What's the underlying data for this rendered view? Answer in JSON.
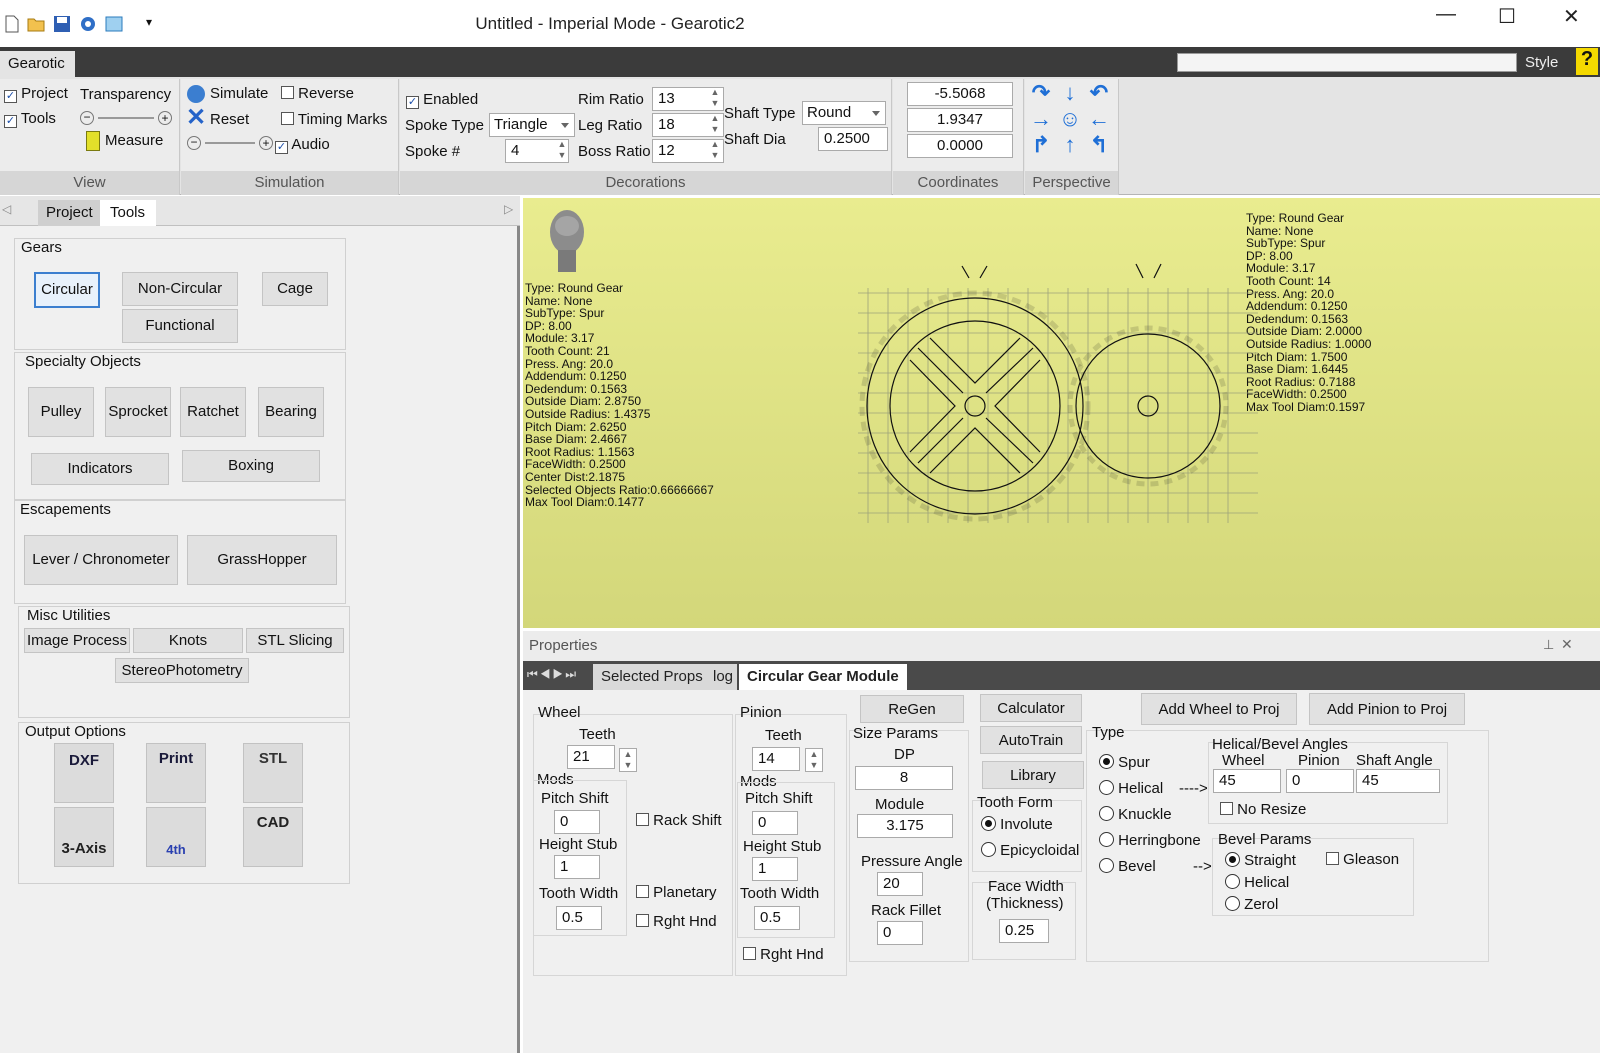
{
  "window": {
    "title": "Untitled -  Imperial Mode - Gearotic2",
    "minimize": "—",
    "maximize": "☐",
    "close": "✕",
    "qa_overflow": "▾"
  },
  "menubar": {
    "tab": "Gearotic",
    "style": "Style",
    "help": "?"
  },
  "ribbon": {
    "view": {
      "label": "View",
      "project": "Project",
      "tools": "Tools",
      "transparency": "Transparency",
      "measure": "Measure"
    },
    "simulation": {
      "label": "Simulation",
      "simulate": "Simulate",
      "reverse": "Reverse",
      "reset": "Reset",
      "timing_marks": "Timing Marks",
      "audio": "Audio"
    },
    "decorations": {
      "label": "Decorations",
      "enabled": "Enabled",
      "spoke_type_label": "Spoke Type",
      "spoke_type": "Triangle",
      "spoke_num_label": "Spoke #",
      "spoke_num": "4",
      "rim_ratio_label": "Rim Ratio",
      "rim_ratio": "13",
      "leg_ratio_label": "Leg Ratio",
      "leg_ratio": "18",
      "boss_ratio_label": "Boss Ratio",
      "boss_ratio": "12",
      "shaft_type_label": "Shaft Type",
      "shaft_type": "Round",
      "shaft_dia_label": "Shaft Dia",
      "shaft_dia": "0.2500"
    },
    "coordinates": {
      "label": "Coordinates",
      "x": "-5.5068",
      "y": "1.9347",
      "z": "0.0000"
    },
    "perspective": {
      "label": "Perspective"
    }
  },
  "leftpane": {
    "tabs": [
      "Project",
      "Tools"
    ],
    "gears": {
      "title": "Gears",
      "circular": "Circular",
      "non_circular": "Non-Circular",
      "cage": "Cage",
      "functional": "Functional"
    },
    "specialty": {
      "title": "Specialty Objects",
      "pulley": "Pulley",
      "sprocket": "Sprocket",
      "ratchet": "Ratchet",
      "bearing": "Bearing",
      "indicators": "Indicators",
      "boxing": "Boxing"
    },
    "escapements": {
      "title": "Escapements",
      "lever": "Lever / Chronometer",
      "grasshopper": "GrassHopper"
    },
    "misc": {
      "title": "Misc Utilities",
      "image_process": "Image Process",
      "knots": "Knots",
      "stl_slicing": "STL Slicing",
      "stereo": "StereoPhotometry"
    },
    "output": {
      "title": "Output Options",
      "dxf": "DXF",
      "print": "Print",
      "stl": "STL",
      "axis3": "3-Axis",
      "fourth": "4th",
      "cad": "CAD"
    }
  },
  "viewport": {
    "left_info": "Type: Round Gear\nName: None\nSubType: Spur\nDP: 8.00\nModule: 3.17\nTooth Count: 21\nPress. Ang: 20.0\nAddendum: 0.1250\nDedendum: 0.1563\nOutside Diam: 2.8750\nOutside Radius: 1.4375\nPitch Diam: 2.6250\nBase Diam: 2.4667\nRoot Radius: 1.1563\nFaceWidth: 0.2500\nCenter Dist:2.1875\nSelected Objects Ratio:0.66666667\nMax Tool Diam:0.1477",
    "right_info": "Type: Round Gear\nName: None\nSubType: Spur\nDP: 8.00\nModule: 3.17\nTooth Count: 14\nPress. Ang: 20.0\nAddendum: 0.1250\nDedendum: 0.1563\nOutside Diam: 2.0000\nOutside Radius: 1.0000\nPitch Diam: 1.7500\nBase Diam: 1.6445\nRoot Radius: 0.7188\nFaceWidth: 0.2500\nMax Tool Diam:0.1597"
  },
  "properties": {
    "title": "Properties",
    "tabs": [
      "Selected Props",
      "log",
      "Circular Gear Module"
    ],
    "wheel": {
      "title": "Wheel",
      "teeth_label": "Teeth",
      "teeth": "21",
      "mods": "Mods",
      "pitch_shift_label": "Pitch Shift",
      "pitch_shift": "0",
      "height_stub_label": "Height Stub",
      "height_stub": "1",
      "tooth_width_label": "Tooth Width",
      "tooth_width": "0.5",
      "rack_shift": "Rack Shift",
      "planetary": "Planetary",
      "rght_hnd": "Rght Hnd"
    },
    "pinion": {
      "title": "Pinion",
      "teeth_label": "Teeth",
      "teeth": "14",
      "mods": "Mods",
      "pitch_shift_label": "Pitch Shift",
      "pitch_shift": "0",
      "height_stub_label": "Height Stub",
      "height_stub": "1",
      "tooth_width_label": "Tooth Width",
      "tooth_width": "0.5",
      "rght_hnd": "Rght Hnd"
    },
    "regen": "ReGen",
    "size": {
      "title": "Size Params",
      "dp_label": "DP",
      "dp": "8",
      "module_label": "Module",
      "module": "3.175",
      "pressure_label": "Pressure Angle",
      "pressure": "20",
      "fillet_label": "Rack Fillet",
      "fillet": "0"
    },
    "calculator": "Calculator",
    "autotrain": "AutoTrain",
    "library": "Library",
    "tooth_form": {
      "title": "Tooth Form",
      "involute": "Involute",
      "epicycloidal": "Epicycloidal"
    },
    "face_width": {
      "title1": "Face Width",
      "title2": "(Thickness)",
      "value": "0.25"
    },
    "add_wheel": "Add Wheel to Proj",
    "add_pinion": "Add Pinion to Proj",
    "type": {
      "title": "Type",
      "spur": "Spur",
      "helical": "Helical",
      "arrow1": "---->",
      "knuckle": "Knuckle",
      "herringbone": "Herringbone",
      "bevel": "Bevel",
      "arrow2": "-->"
    },
    "helical": {
      "title": "Helical/Bevel Angles",
      "wheel_label": "Wheel",
      "wheel": "45",
      "pinion_label": "Pinion",
      "pinion": "0",
      "shaft_label": "Shaft Angle",
      "shaft": "45",
      "no_resize": "No Resize"
    },
    "bevel": {
      "title": "Bevel Params",
      "straight": "Straight",
      "helical": "Helical",
      "zerol": "Zerol",
      "gleason": "Gleason"
    }
  }
}
